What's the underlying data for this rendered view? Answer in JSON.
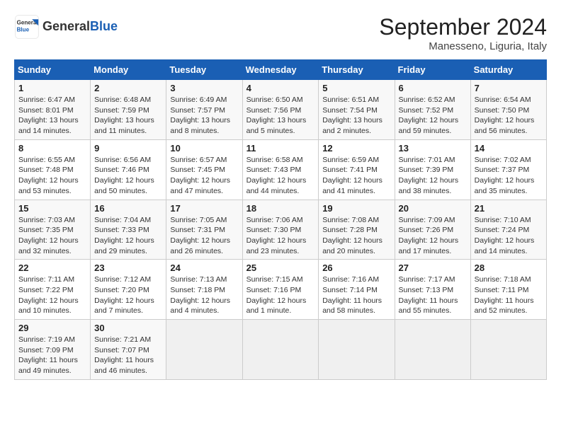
{
  "header": {
    "logo_text_general": "General",
    "logo_text_blue": "Blue",
    "month_title": "September 2024",
    "location": "Manesseno, Liguria, Italy"
  },
  "calendar": {
    "days_of_week": [
      "Sunday",
      "Monday",
      "Tuesday",
      "Wednesday",
      "Thursday",
      "Friday",
      "Saturday"
    ],
    "weeks": [
      [
        {
          "day": "",
          "empty": true
        },
        {
          "day": "",
          "empty": true
        },
        {
          "day": "",
          "empty": true
        },
        {
          "day": "",
          "empty": true
        },
        {
          "day": "5",
          "sunrise": "6:51 AM",
          "sunset": "7:54 PM",
          "daylight": "13 hours and 2 minutes."
        },
        {
          "day": "6",
          "sunrise": "6:52 AM",
          "sunset": "7:52 PM",
          "daylight": "12 hours and 59 minutes."
        },
        {
          "day": "7",
          "sunrise": "6:54 AM",
          "sunset": "7:50 PM",
          "daylight": "12 hours and 56 minutes."
        }
      ],
      [
        {
          "day": "1",
          "sunrise": "6:47 AM",
          "sunset": "8:01 PM",
          "daylight": "13 hours and 14 minutes."
        },
        {
          "day": "2",
          "sunrise": "6:48 AM",
          "sunset": "7:59 PM",
          "daylight": "13 hours and 11 minutes."
        },
        {
          "day": "3",
          "sunrise": "6:49 AM",
          "sunset": "7:57 PM",
          "daylight": "13 hours and 8 minutes."
        },
        {
          "day": "4",
          "sunrise": "6:50 AM",
          "sunset": "7:56 PM",
          "daylight": "13 hours and 5 minutes."
        },
        {
          "day": "5",
          "sunrise": "6:51 AM",
          "sunset": "7:54 PM",
          "daylight": "13 hours and 2 minutes."
        },
        {
          "day": "6",
          "sunrise": "6:52 AM",
          "sunset": "7:52 PM",
          "daylight": "12 hours and 59 minutes."
        },
        {
          "day": "7",
          "sunrise": "6:54 AM",
          "sunset": "7:50 PM",
          "daylight": "12 hours and 56 minutes."
        }
      ],
      [
        {
          "day": "8",
          "sunrise": "6:55 AM",
          "sunset": "7:48 PM",
          "daylight": "12 hours and 53 minutes."
        },
        {
          "day": "9",
          "sunrise": "6:56 AM",
          "sunset": "7:46 PM",
          "daylight": "12 hours and 50 minutes."
        },
        {
          "day": "10",
          "sunrise": "6:57 AM",
          "sunset": "7:45 PM",
          "daylight": "12 hours and 47 minutes."
        },
        {
          "day": "11",
          "sunrise": "6:58 AM",
          "sunset": "7:43 PM",
          "daylight": "12 hours and 44 minutes."
        },
        {
          "day": "12",
          "sunrise": "6:59 AM",
          "sunset": "7:41 PM",
          "daylight": "12 hours and 41 minutes."
        },
        {
          "day": "13",
          "sunrise": "7:01 AM",
          "sunset": "7:39 PM",
          "daylight": "12 hours and 38 minutes."
        },
        {
          "day": "14",
          "sunrise": "7:02 AM",
          "sunset": "7:37 PM",
          "daylight": "12 hours and 35 minutes."
        }
      ],
      [
        {
          "day": "15",
          "sunrise": "7:03 AM",
          "sunset": "7:35 PM",
          "daylight": "12 hours and 32 minutes."
        },
        {
          "day": "16",
          "sunrise": "7:04 AM",
          "sunset": "7:33 PM",
          "daylight": "12 hours and 29 minutes."
        },
        {
          "day": "17",
          "sunrise": "7:05 AM",
          "sunset": "7:31 PM",
          "daylight": "12 hours and 26 minutes."
        },
        {
          "day": "18",
          "sunrise": "7:06 AM",
          "sunset": "7:30 PM",
          "daylight": "12 hours and 23 minutes."
        },
        {
          "day": "19",
          "sunrise": "7:08 AM",
          "sunset": "7:28 PM",
          "daylight": "12 hours and 20 minutes."
        },
        {
          "day": "20",
          "sunrise": "7:09 AM",
          "sunset": "7:26 PM",
          "daylight": "12 hours and 17 minutes."
        },
        {
          "day": "21",
          "sunrise": "7:10 AM",
          "sunset": "7:24 PM",
          "daylight": "12 hours and 14 minutes."
        }
      ],
      [
        {
          "day": "22",
          "sunrise": "7:11 AM",
          "sunset": "7:22 PM",
          "daylight": "12 hours and 10 minutes."
        },
        {
          "day": "23",
          "sunrise": "7:12 AM",
          "sunset": "7:20 PM",
          "daylight": "12 hours and 7 minutes."
        },
        {
          "day": "24",
          "sunrise": "7:13 AM",
          "sunset": "7:18 PM",
          "daylight": "12 hours and 4 minutes."
        },
        {
          "day": "25",
          "sunrise": "7:15 AM",
          "sunset": "7:16 PM",
          "daylight": "12 hours and 1 minute."
        },
        {
          "day": "26",
          "sunrise": "7:16 AM",
          "sunset": "7:14 PM",
          "daylight": "11 hours and 58 minutes."
        },
        {
          "day": "27",
          "sunrise": "7:17 AM",
          "sunset": "7:13 PM",
          "daylight": "11 hours and 55 minutes."
        },
        {
          "day": "28",
          "sunrise": "7:18 AM",
          "sunset": "7:11 PM",
          "daylight": "11 hours and 52 minutes."
        }
      ],
      [
        {
          "day": "29",
          "sunrise": "7:19 AM",
          "sunset": "7:09 PM",
          "daylight": "11 hours and 49 minutes."
        },
        {
          "day": "30",
          "sunrise": "7:21 AM",
          "sunset": "7:07 PM",
          "daylight": "11 hours and 46 minutes."
        },
        {
          "day": "",
          "empty": true
        },
        {
          "day": "",
          "empty": true
        },
        {
          "day": "",
          "empty": true
        },
        {
          "day": "",
          "empty": true
        },
        {
          "day": "",
          "empty": true
        }
      ]
    ]
  }
}
